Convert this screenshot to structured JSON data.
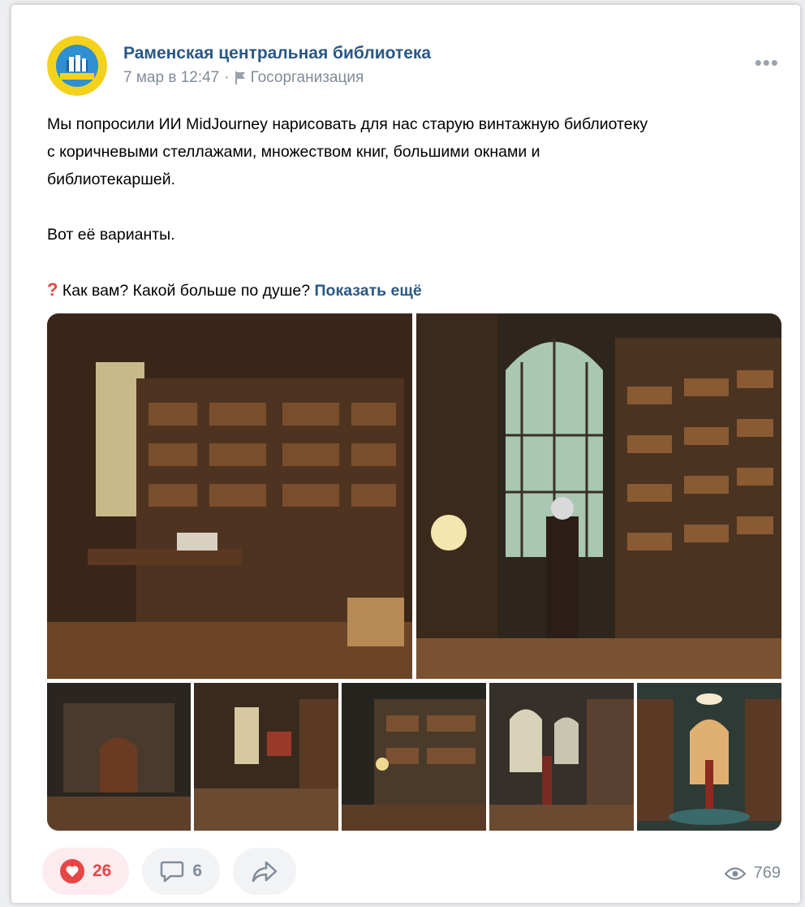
{
  "post": {
    "author": "Раменская центральная библиотека",
    "date": "7 мар в 12:47",
    "separator": "·",
    "org_type": "Госорганизация",
    "text_lines": [
      "Мы попросили ИИ MidJourney нарисовать для нас старую винтажную библиотеку",
      "с коричневыми стеллажами, множеством книг, большими окнами и",
      "библиотекаршей."
    ],
    "text_variants": "Вот её варианты.",
    "question": "Как вам? Какой больше по душе?",
    "show_more": "Показать ещё"
  },
  "gallery": {
    "photos": [
      {
        "name": "library-image-1",
        "tone": "#4a3020"
      },
      {
        "name": "library-image-2",
        "tone": "#3a3428"
      },
      {
        "name": "library-image-3",
        "tone": "#3d3329"
      },
      {
        "name": "library-image-4",
        "tone": "#4b3524"
      },
      {
        "name": "library-image-5",
        "tone": "#2f3a32"
      },
      {
        "name": "library-image-6",
        "tone": "#54402c"
      },
      {
        "name": "library-image-7",
        "tone": "#3c4a46"
      }
    ]
  },
  "actions": {
    "likes": "26",
    "comments": "6",
    "views": "769"
  },
  "colors": {
    "link": "#2a5885",
    "like": "#e64646",
    "muted": "#818c99"
  },
  "icons": [
    "avatar-logo",
    "flag-icon",
    "more-icon",
    "heart-icon",
    "comment-icon",
    "share-icon",
    "eye-icon"
  ]
}
